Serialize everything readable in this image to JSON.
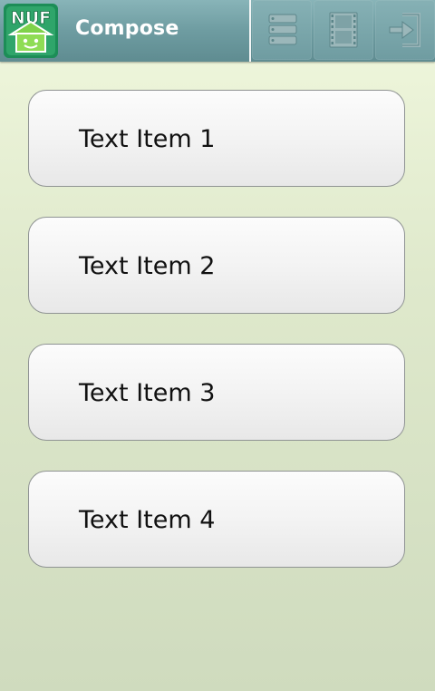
{
  "action_bar": {
    "title": "Compose",
    "logo_text": "NUF",
    "logo_icon": "android-house-logo",
    "buttons": [
      {
        "icon": "list-icon"
      },
      {
        "icon": "film-icon"
      },
      {
        "icon": "exit-icon"
      }
    ],
    "colors": {
      "bar": "#6e9ca1",
      "title": "#ffffff"
    }
  },
  "items": [
    {
      "label": "Text Item 1"
    },
    {
      "label": "Text Item 2"
    },
    {
      "label": "Text Item 3"
    },
    {
      "label": "Text Item 4"
    }
  ]
}
